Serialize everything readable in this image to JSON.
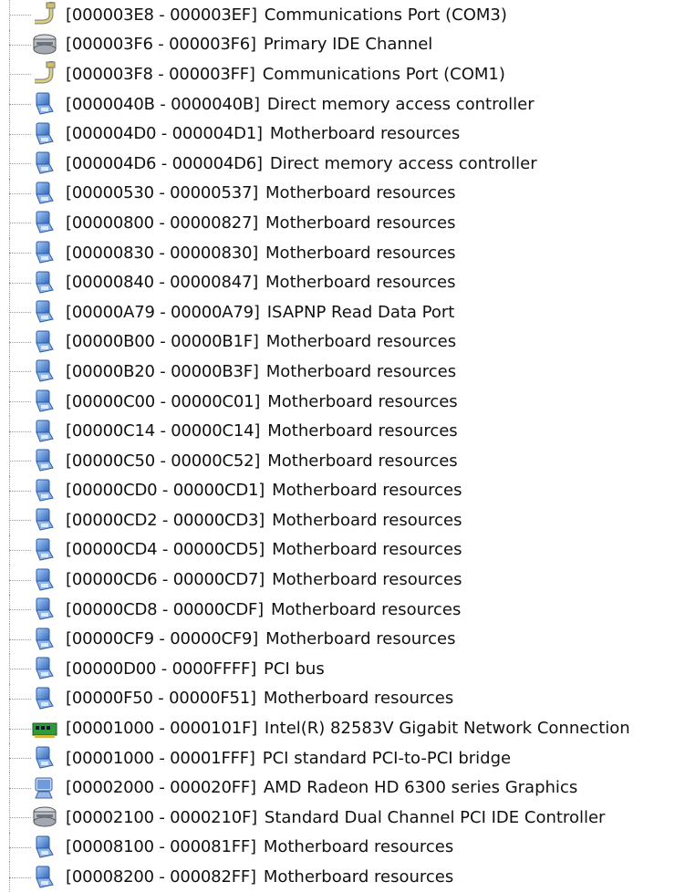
{
  "resources": [
    {
      "range": "[000003E8 - 000003EF]",
      "name": "Communications Port (COM3)",
      "icon": "port-icon"
    },
    {
      "range": "[000003F6 - 000003F6]",
      "name": "Primary IDE Channel",
      "icon": "ide-icon"
    },
    {
      "range": "[000003F8 - 000003FF]",
      "name": "Communications Port (COM1)",
      "icon": "port-icon"
    },
    {
      "range": "[0000040B - 0000040B]",
      "name": "Direct memory access controller",
      "icon": "system-device-icon"
    },
    {
      "range": "[000004D0 - 000004D1]",
      "name": "Motherboard resources",
      "icon": "system-device-icon"
    },
    {
      "range": "[000004D6 - 000004D6]",
      "name": "Direct memory access controller",
      "icon": "system-device-icon"
    },
    {
      "range": "[00000530 - 00000537]",
      "name": "Motherboard resources",
      "icon": "system-device-icon"
    },
    {
      "range": "[00000800 - 00000827]",
      "name": "Motherboard resources",
      "icon": "system-device-icon"
    },
    {
      "range": "[00000830 - 00000830]",
      "name": "Motherboard resources",
      "icon": "system-device-icon"
    },
    {
      "range": "[00000840 - 00000847]",
      "name": "Motherboard resources",
      "icon": "system-device-icon"
    },
    {
      "range": "[00000A79 - 00000A79]",
      "name": "ISAPNP Read Data Port",
      "icon": "system-device-icon"
    },
    {
      "range": "[00000B00 - 00000B1F]",
      "name": "Motherboard resources",
      "icon": "system-device-icon"
    },
    {
      "range": "[00000B20 - 00000B3F]",
      "name": "Motherboard resources",
      "icon": "system-device-icon"
    },
    {
      "range": "[00000C00 - 00000C01]",
      "name": "Motherboard resources",
      "icon": "system-device-icon"
    },
    {
      "range": "[00000C14 - 00000C14]",
      "name": "Motherboard resources",
      "icon": "system-device-icon"
    },
    {
      "range": "[00000C50 - 00000C52]",
      "name": "Motherboard resources",
      "icon": "system-device-icon"
    },
    {
      "range": "[00000CD0 - 00000CD1]",
      "name": "Motherboard resources",
      "icon": "system-device-icon"
    },
    {
      "range": "[00000CD2 - 00000CD3]",
      "name": "Motherboard resources",
      "icon": "system-device-icon"
    },
    {
      "range": "[00000CD4 - 00000CD5]",
      "name": "Motherboard resources",
      "icon": "system-device-icon"
    },
    {
      "range": "[00000CD6 - 00000CD7]",
      "name": "Motherboard resources",
      "icon": "system-device-icon"
    },
    {
      "range": "[00000CD8 - 00000CDF]",
      "name": "Motherboard resources",
      "icon": "system-device-icon"
    },
    {
      "range": "[00000CF9 - 00000CF9]",
      "name": "Motherboard resources",
      "icon": "system-device-icon"
    },
    {
      "range": "[00000D00 - 0000FFFF]",
      "name": "PCI bus",
      "icon": "system-device-icon"
    },
    {
      "range": "[00000F50 - 00000F51]",
      "name": "Motherboard resources",
      "icon": "system-device-icon"
    },
    {
      "range": "[00001000 - 0000101F]",
      "name": "Intel(R) 82583V Gigabit Network Connection",
      "icon": "network-adapter-icon"
    },
    {
      "range": "[00001000 - 00001FFF]",
      "name": "PCI standard PCI-to-PCI bridge",
      "icon": "system-device-icon"
    },
    {
      "range": "[00002000 - 000020FF]",
      "name": "AMD Radeon HD 6300 series Graphics",
      "icon": "display-adapter-icon"
    },
    {
      "range": "[00002100 - 0000210F]",
      "name": "Standard Dual Channel PCI IDE Controller",
      "icon": "ide-icon"
    },
    {
      "range": "[00008100 - 000081FF]",
      "name": "Motherboard resources",
      "icon": "system-device-icon"
    },
    {
      "range": "[00008200 - 000082FF]",
      "name": "Motherboard resources",
      "icon": "system-device-icon"
    }
  ],
  "colors": {
    "system_device_blue": "#3f7fd9",
    "port_yellow": "#d9c25a",
    "ide_gray": "#8a8f98",
    "network_green": "#2f9a3a",
    "display_blue": "#5a8ad0"
  }
}
